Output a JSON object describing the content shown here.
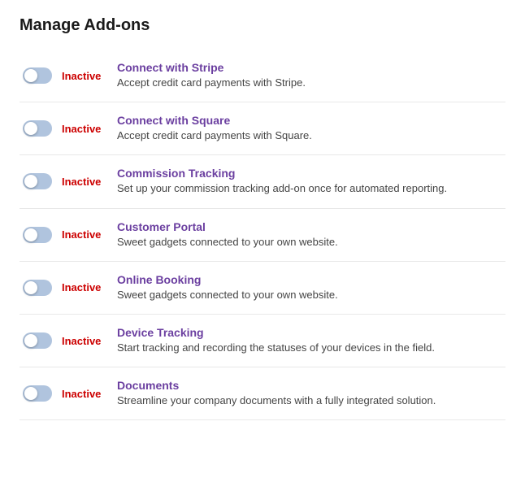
{
  "page": {
    "title": "Manage Add-ons"
  },
  "addons": [
    {
      "id": "stripe",
      "status": "Inactive",
      "name": "Connect with Stripe",
      "description": "Accept credit card payments with Stripe."
    },
    {
      "id": "square",
      "status": "Inactive",
      "name": "Connect with Square",
      "description": "Accept credit card payments with Square."
    },
    {
      "id": "commission",
      "status": "Inactive",
      "name": "Commission Tracking",
      "description": "Set up your commission tracking add-on once for automated reporting."
    },
    {
      "id": "customer-portal",
      "status": "Inactive",
      "name": "Customer Portal",
      "description": "Sweet gadgets connected to your own website."
    },
    {
      "id": "online-booking",
      "status": "Inactive",
      "name": "Online Booking",
      "description": "Sweet gadgets connected to your own website."
    },
    {
      "id": "device-tracking",
      "status": "Inactive",
      "name": "Device Tracking",
      "description": "Start tracking and recording the statuses of your devices in the field."
    },
    {
      "id": "documents",
      "status": "Inactive",
      "name": "Documents",
      "description": "Streamline your company documents with a fully integrated solution."
    }
  ]
}
